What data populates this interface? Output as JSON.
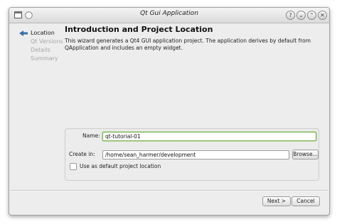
{
  "window": {
    "title": "Qt Gui Application",
    "window_icon": "window-app-icon",
    "controls": {
      "help_glyph": "?",
      "minimize_glyph": "⌄",
      "maximize_glyph": "⌃",
      "close_glyph": "✕"
    }
  },
  "sidebar": {
    "items": [
      {
        "label": "Location",
        "active": true
      },
      {
        "label": "Qt Versions",
        "active": false
      },
      {
        "label": "Details",
        "active": false
      },
      {
        "label": "Summary",
        "active": false
      }
    ]
  },
  "page": {
    "heading": "Introduction and Project Location",
    "description": "This wizard generates a Qt4 GUI application project. The application derives by default from QApplication and includes an empty widget."
  },
  "form": {
    "name_label": "Name:",
    "name_value": "qt-tutorial-01",
    "create_in_label": "Create in:",
    "create_in_value": "/home/sean_harmer/development",
    "browse_label": "Browse...",
    "default_location_label": "Use as default project location",
    "default_location_checked": false
  },
  "footer": {
    "next_label": "Next >",
    "cancel_label": "Cancel"
  },
  "colors": {
    "focus_border": "#7fb05b",
    "active_arrow": "#3a6ea5"
  }
}
